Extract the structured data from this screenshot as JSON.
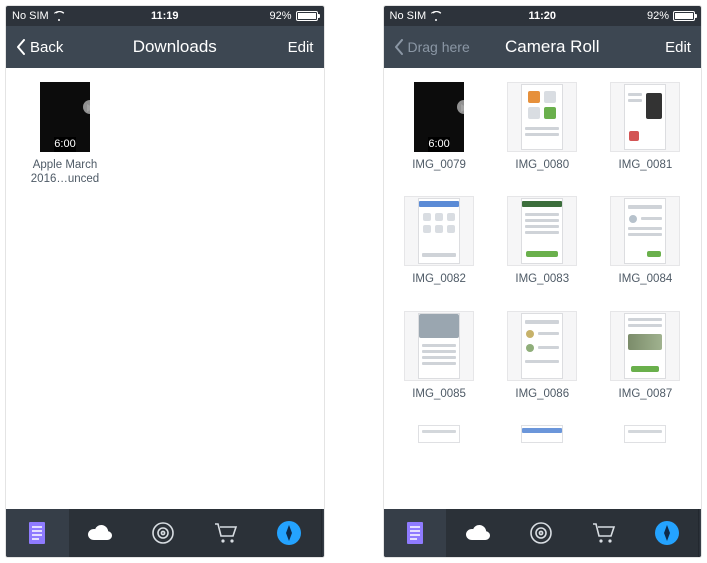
{
  "left": {
    "status": {
      "carrier": "No SIM",
      "time": "11:19",
      "battery": "92%"
    },
    "nav": {
      "back_label": "Back",
      "title": "Downloads",
      "edit_label": "Edit"
    },
    "items": [
      {
        "label": "Apple March 2016…unced",
        "duration": "6:00",
        "type": "video"
      }
    ]
  },
  "right": {
    "status": {
      "carrier": "No SIM",
      "time": "11:20",
      "battery": "92%"
    },
    "nav": {
      "drag_label": "Drag here",
      "title": "Camera Roll",
      "edit_label": "Edit"
    },
    "items": [
      {
        "label": "IMG_0079",
        "duration": "6:00",
        "type": "video"
      },
      {
        "label": "IMG_0080",
        "type": "app-icons"
      },
      {
        "label": "IMG_0081",
        "type": "app-phone"
      },
      {
        "label": "IMG_0082",
        "type": "files-grid"
      },
      {
        "label": "IMG_0083",
        "type": "web-green"
      },
      {
        "label": "IMG_0084",
        "type": "web-text"
      },
      {
        "label": "IMG_0085",
        "type": "panel-list"
      },
      {
        "label": "IMG_0086",
        "type": "web-text2"
      },
      {
        "label": "IMG_0087",
        "type": "web-people"
      }
    ]
  },
  "tabs": {
    "doc": "documents-tab",
    "cloud": "cloud-tab",
    "wifi": "wifi-tab",
    "cart": "cart-tab",
    "compass": "compass-tab"
  }
}
